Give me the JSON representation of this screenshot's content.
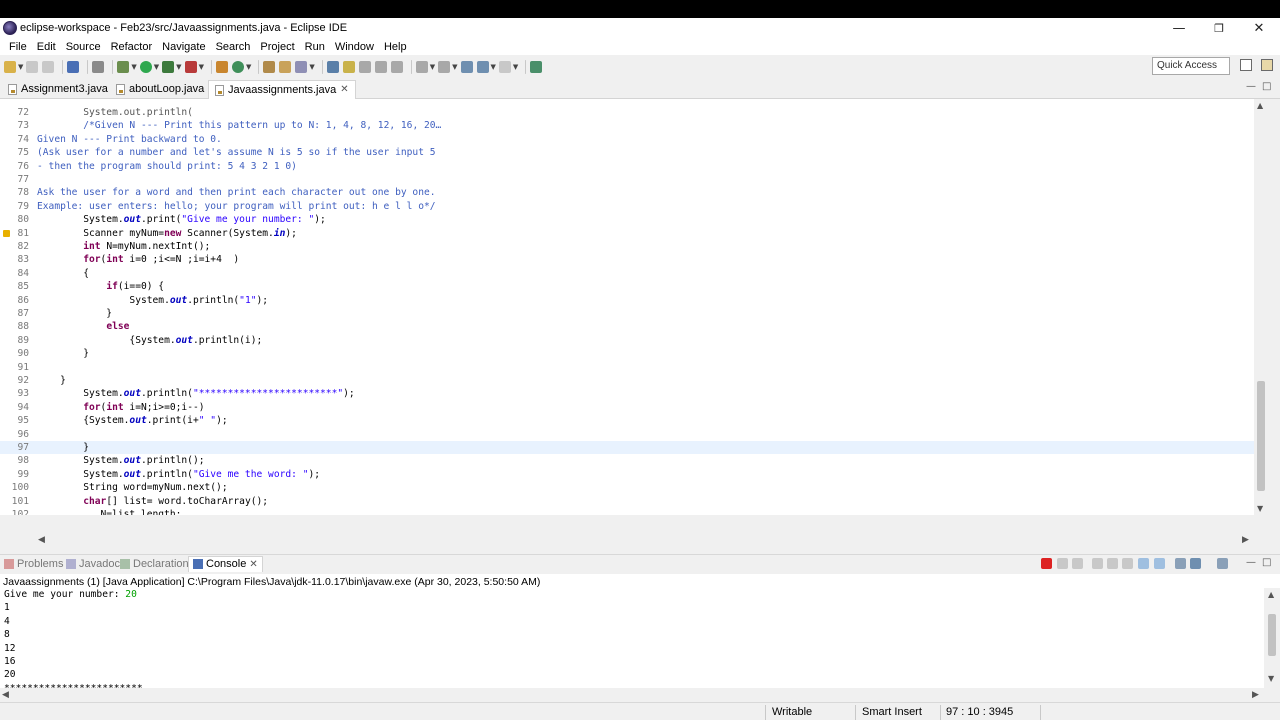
{
  "window": {
    "title": "eclipse-workspace - Feb23/src/Javaassignments.java - Eclipse IDE",
    "minimize": "—",
    "maximize": "❐",
    "close": "✕"
  },
  "menu": [
    "File",
    "Edit",
    "Source",
    "Refactor",
    "Navigate",
    "Search",
    "Project",
    "Run",
    "Window",
    "Help"
  ],
  "toolbar": {
    "quick_access_placeholder": "Quick Access"
  },
  "editor_tabs": [
    {
      "label": "Assignment3.java",
      "active": false
    },
    {
      "label": "aboutLoop.java",
      "active": false
    },
    {
      "label": "Javaassignments.java",
      "active": true,
      "close": "✕"
    }
  ],
  "code": {
    "current_line": 97,
    "lines": [
      {
        "n": "72",
        "t": ""
      },
      {
        "n": "73",
        "t": "        /*Given N --- Print this pattern up to N: 1, 4, 8, 12, 16, 20…"
      },
      {
        "n": "74",
        "t": "Given N --- Print backward to 0."
      },
      {
        "n": "75",
        "t": "(Ask user for a number and let's assume N is 5 so if the user input 5"
      },
      {
        "n": "76",
        "t": "- then the program should print: 5 4 3 2 1 0)"
      },
      {
        "n": "77",
        "t": ""
      },
      {
        "n": "78",
        "t": "Ask the user for a word and then print each character out one by one."
      },
      {
        "n": "79",
        "t": "Example: user enters: hello; your program will print out: h e l l o*/"
      },
      {
        "n": "80",
        "t": "        System.out.print(\"Give me your number: \");"
      },
      {
        "n": "81",
        "t": "        Scanner myNum=new Scanner(System.in);"
      },
      {
        "n": "82",
        "t": "        int N=myNum.nextInt();"
      },
      {
        "n": "83",
        "t": "        for(int i=0 ;i<=N ;i=i+4  )"
      },
      {
        "n": "84",
        "t": "        {"
      },
      {
        "n": "85",
        "t": "            if(i==0) {"
      },
      {
        "n": "86",
        "t": "                System.out.println(\"1\");"
      },
      {
        "n": "87",
        "t": "            }"
      },
      {
        "n": "88",
        "t": "            else"
      },
      {
        "n": "89",
        "t": "                {System.out.println(i);"
      },
      {
        "n": "90",
        "t": "        }"
      },
      {
        "n": "91",
        "t": ""
      },
      {
        "n": "92",
        "t": "    }"
      },
      {
        "n": "93",
        "t": "        System.out.println(\"************************\");"
      },
      {
        "n": "94",
        "t": "        for(int i=N;i>=0;i--)"
      },
      {
        "n": "95",
        "t": "        {System.out.print(i+\" \");"
      },
      {
        "n": "96",
        "t": ""
      },
      {
        "n": "97",
        "t": "        }"
      },
      {
        "n": "98",
        "t": "        System.out.println();"
      },
      {
        "n": "99",
        "t": "        System.out.println(\"Give me the word: \");"
      },
      {
        "n": "100",
        "t": "        String word=myNum.next();"
      },
      {
        "n": "101",
        "t": "        char[] list= word.toCharArray();"
      },
      {
        "n": "102",
        "t": "           N=list.length;"
      }
    ]
  },
  "bottom_tabs": [
    {
      "label": "Problems",
      "active": false
    },
    {
      "label": "Javadoc",
      "active": false
    },
    {
      "label": "Declaration",
      "active": false
    },
    {
      "label": "Console",
      "active": true,
      "close": "✕"
    }
  ],
  "console": {
    "description": "Javaassignments (1) [Java Application] C:\\Program Files\\Java\\jdk-11.0.17\\bin\\javaw.exe (Apr 30, 2023, 5:50:50 AM)",
    "prompt": "Give me your number: ",
    "user_input": "20",
    "output": [
      "1",
      "4",
      "8",
      "12",
      "16",
      "20",
      "************************"
    ]
  },
  "status": {
    "writable": "Writable",
    "insert_mode": "Smart Insert",
    "position": "97 : 10 : 3945"
  },
  "colors": {
    "keyword": "#7f0055",
    "comment": "#3f5fbf",
    "string": "#2a00ff",
    "field": "#0000c0",
    "current_line": "#e8f2fe",
    "console_input": "#00a000"
  }
}
